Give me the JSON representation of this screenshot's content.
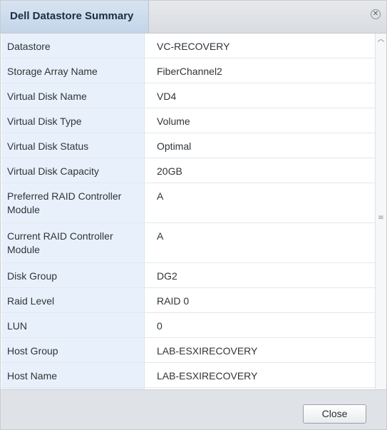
{
  "dialog": {
    "title": "Dell Datastore Summary",
    "close_icon_glyph": "✕",
    "close_button_label": "Close"
  },
  "rows": [
    {
      "label": "Datastore",
      "value": "VC-RECOVERY"
    },
    {
      "label": "Storage Array Name",
      "value": "FiberChannel2"
    },
    {
      "label": "Virtual Disk Name",
      "value": "VD4"
    },
    {
      "label": "Virtual Disk Type",
      "value": "Volume"
    },
    {
      "label": "Virtual Disk Status",
      "value": "Optimal"
    },
    {
      "label": "Virtual Disk Capacity",
      "value": "20GB"
    },
    {
      "label": "Preferred RAID Controller Module",
      "value": "A"
    },
    {
      "label": "Current RAID Controller Module",
      "value": "A"
    },
    {
      "label": "Disk Group",
      "value": "DG2"
    },
    {
      "label": "Raid Level",
      "value": "RAID 0"
    },
    {
      "label": "LUN",
      "value": "0"
    },
    {
      "label": "Host Group",
      "value": "LAB-ESXIRECOVERY"
    },
    {
      "label": "Host Name",
      "value": "LAB-ESXIRECOVERY"
    }
  ],
  "scrollbar": {
    "up_arrow_glyph": "︿",
    "grip_glyph": "≡"
  },
  "colors": {
    "label_bg": "#e8f1fb",
    "title_tab_bg": "#c4d5e9",
    "footer_bg": "#dfe3e8"
  }
}
